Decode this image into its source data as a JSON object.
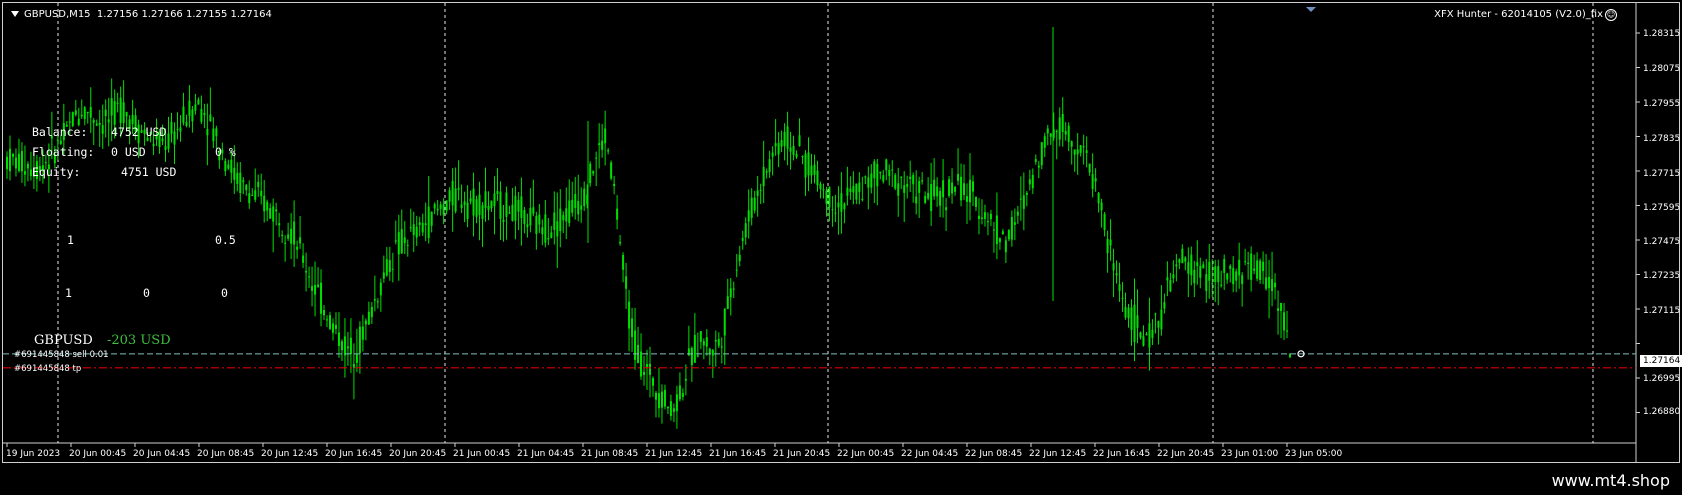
{
  "symbol": {
    "name": "GBPUSD,M15",
    "ohlc": "1.27156 1.27166 1.27155 1.27164"
  },
  "ea": {
    "name": "XFX  Hunter - 62014105 (V2.0)_fix"
  },
  "stats": {
    "balance_label": "Balance:",
    "balance_value": "4752 USD",
    "floating_label": "Floating:",
    "floating_value": "0 USD",
    "floating_pct": "0 %",
    "equity_label": "Equity:",
    "equity_value": "4751 USD"
  },
  "grid_numbers": {
    "r1c1": "1",
    "r1c2": "0.5",
    "r2c1": "1",
    "r2c2": "0",
    "r2c3": "0"
  },
  "pair_summary": {
    "pair": "GBPUSD",
    "profit": "-203 USD"
  },
  "orders": [
    {
      "label": "#691445848 sell 0.01"
    },
    {
      "label": "#691445848 tp"
    }
  ],
  "price_axis": [
    "1.28315",
    "1.28075",
    "1.27955",
    "1.27835",
    "1.27715",
    "1.27595",
    "1.27475",
    "1.27235",
    "1.27115",
    "1.26995",
    "1.26880"
  ],
  "current_price": "1.27164",
  "time_axis": [
    "19 Jun 2023",
    "20 Jun 00:45",
    "20 Jun 04:45",
    "20 Jun 08:45",
    "20 Jun 12:45",
    "20 Jun 16:45",
    "20 Jun 20:45",
    "21 Jun 00:45",
    "21 Jun 04:45",
    "21 Jun 08:45",
    "21 Jun 12:45",
    "21 Jun 16:45",
    "21 Jun 20:45",
    "22 Jun 00:45",
    "22 Jun 04:45",
    "22 Jun 08:45",
    "22 Jun 12:45",
    "22 Jun 16:45",
    "22 Jun 20:45",
    "23 Jun 01:00",
    "23 Jun 05:00"
  ],
  "watermark": "www.mt4.shop",
  "colors": {
    "candle": "#00e000",
    "bid_line": "#7fbfbf",
    "tp_line": "#e00000",
    "grid": "#ffffff"
  },
  "price_series": [
    1.2783,
    1.2782,
    1.2781,
    1.278,
    1.2782,
    1.2786,
    1.279,
    1.2797,
    1.28,
    1.2798,
    1.2795,
    1.2797,
    1.2801,
    1.2797,
    1.2793,
    1.279,
    1.2788,
    1.2789,
    1.2793,
    1.2798,
    1.2802,
    1.2798,
    1.279,
    1.2784,
    1.2777,
    1.2773,
    1.277,
    1.2768,
    1.2765,
    1.2762,
    1.2758,
    1.275,
    1.2742,
    1.2735,
    1.2728,
    1.2722,
    1.2717,
    1.272,
    1.2728,
    1.2737,
    1.2746,
    1.2752,
    1.2756,
    1.2757,
    1.2761,
    1.2764,
    1.2767,
    1.277,
    1.277,
    1.2768,
    1.2768,
    1.2767,
    1.2767,
    1.2766,
    1.2764,
    1.2762,
    1.276,
    1.276,
    1.2762,
    1.2765,
    1.2768,
    1.2773,
    1.2783,
    1.2791,
    1.277,
    1.274,
    1.272,
    1.2712,
    1.2707,
    1.2702,
    1.2697,
    1.2705,
    1.2715,
    1.2722,
    1.2718,
    1.272,
    1.2735,
    1.275,
    1.2762,
    1.2772,
    1.278,
    1.2788,
    1.279,
    1.2786,
    1.2782,
    1.2778,
    1.2772,
    1.2768,
    1.2768,
    1.2771,
    1.2773,
    1.2776,
    1.2778,
    1.2777,
    1.2776,
    1.2774,
    1.2772,
    1.277,
    1.277,
    1.2772,
    1.2774,
    1.2771,
    1.2768,
    1.2764,
    1.2759,
    1.2755,
    1.276,
    1.2768,
    1.2778,
    1.2788,
    1.2793,
    1.2795,
    1.279,
    1.2786,
    1.278,
    1.2768,
    1.2752,
    1.274,
    1.273,
    1.2725,
    1.272,
    1.2727,
    1.2736,
    1.2745,
    1.2748,
    1.2745,
    1.2744,
    1.2742,
    1.2742,
    1.2743,
    1.2745,
    1.2746,
    1.2744,
    1.2742,
    1.2734,
    1.2716
  ]
}
